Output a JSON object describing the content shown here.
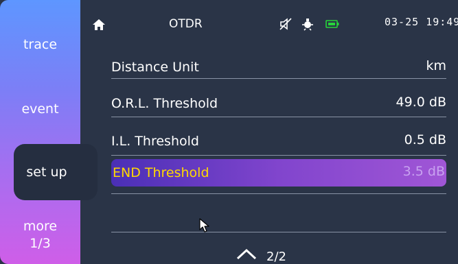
{
  "header": {
    "title": "OTDR",
    "date": "03-25",
    "time": "19:49"
  },
  "sidebar": {
    "items": [
      {
        "label": "trace"
      },
      {
        "label": "event"
      },
      {
        "label": "set up",
        "active": true
      },
      {
        "label": "more",
        "sub": "1/3"
      }
    ]
  },
  "settings": [
    {
      "label": "Distance Unit",
      "value": "km"
    },
    {
      "label": "O.R.L. Threshold",
      "value": "49.0 dB"
    },
    {
      "label": "I.L. Threshold",
      "value": "0.5 dB"
    },
    {
      "label": "END Threshold",
      "value": "3.5 dB",
      "selected": true
    }
  ],
  "pager": {
    "label": "2/2"
  },
  "colors": {
    "background": "#2a3447",
    "highlight_text": "#ffd900",
    "battery": "#27d63a",
    "sidebar_top": "#5e96ff",
    "sidebar_bottom": "#cf5ee8"
  },
  "icons": [
    "home-icon",
    "mute-icon",
    "camera-icon",
    "battery-icon",
    "chevron-up-icon",
    "mouse-cursor-icon"
  ]
}
